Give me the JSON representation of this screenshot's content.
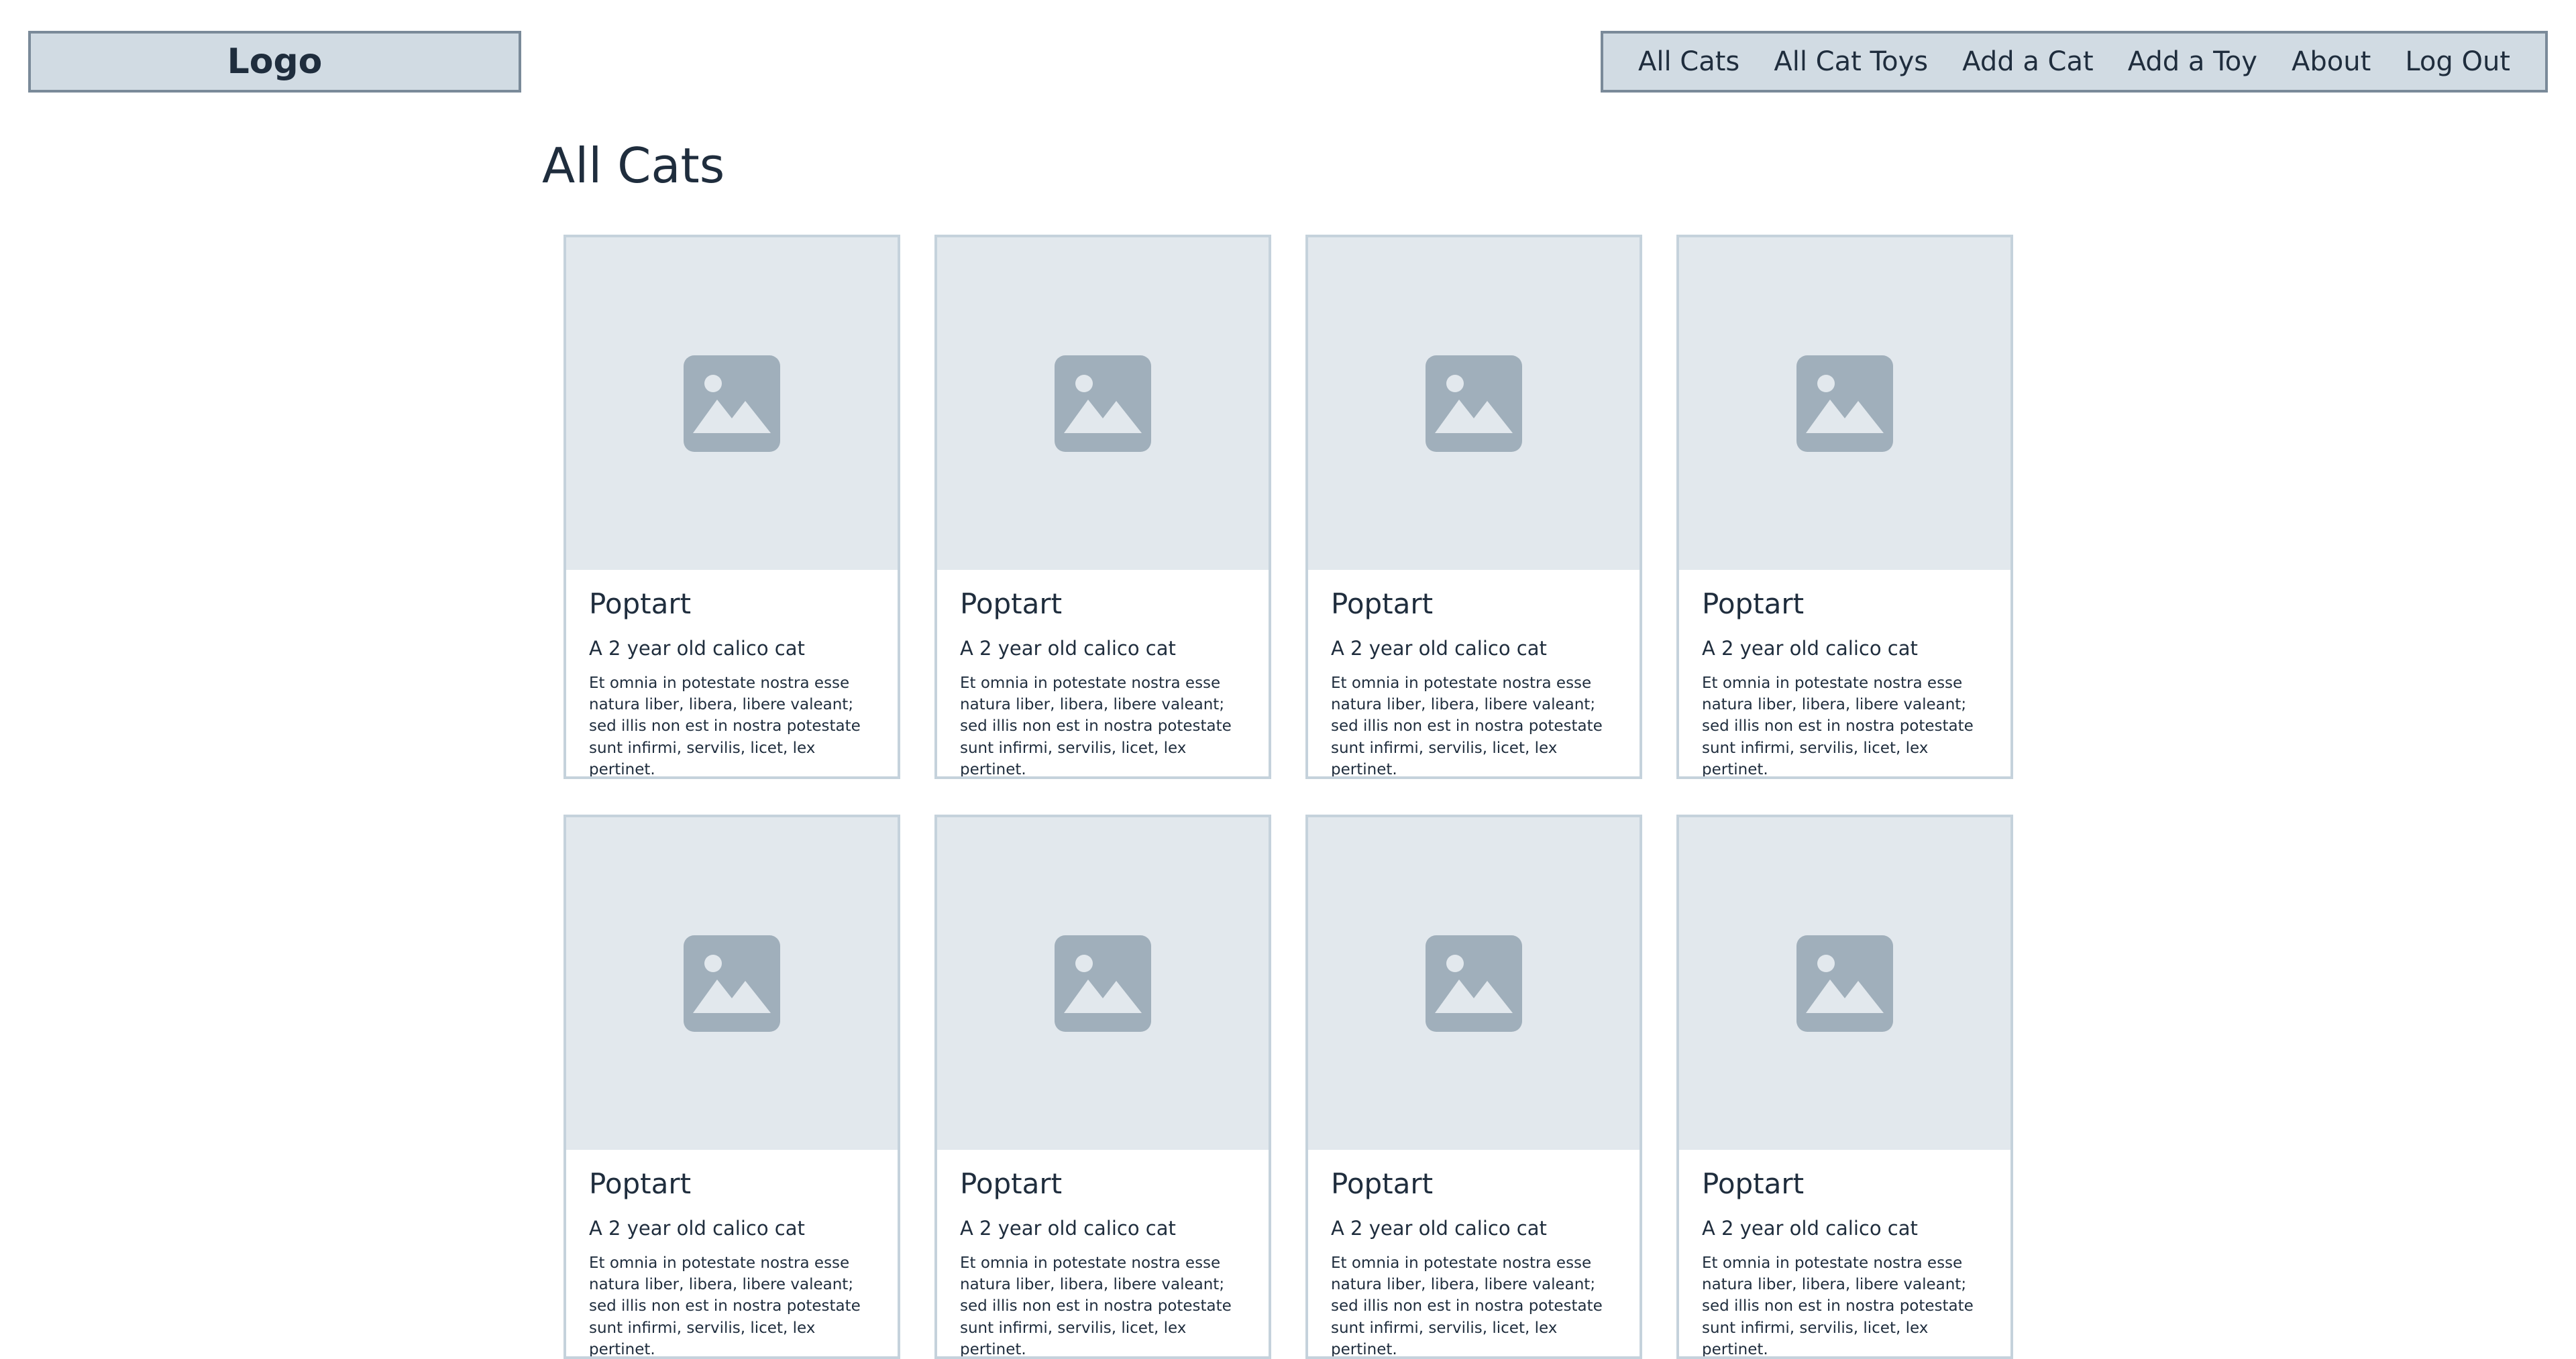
{
  "header": {
    "logo_label": "Logo",
    "nav": [
      "All Cats",
      "All Cat Toys",
      "Add a Cat",
      "Add a Toy",
      "About",
      "Log Out"
    ]
  },
  "main": {
    "title": "All Cats",
    "cards": [
      {
        "name": "Poptart",
        "subtitle": "A 2 year old calico cat",
        "description": "Et omnia in potestate nostra esse natura liber, libera, libere valeant; sed illis non est in nostra potestate sunt infirmi, servilis, licet, lex pertinet.",
        "image_icon": "image-placeholder-icon"
      },
      {
        "name": "Poptart",
        "subtitle": "A 2 year old calico cat",
        "description": "Et omnia in potestate nostra esse natura liber, libera, libere valeant; sed illis non est in nostra potestate sunt infirmi, servilis, licet, lex pertinet.",
        "image_icon": "image-placeholder-icon"
      },
      {
        "name": "Poptart",
        "subtitle": "A 2 year old calico cat",
        "description": "Et omnia in potestate nostra esse natura liber, libera, libere valeant; sed illis non est in nostra potestate sunt infirmi, servilis, licet, lex pertinet.",
        "image_icon": "image-placeholder-icon"
      },
      {
        "name": "Poptart",
        "subtitle": "A 2 year old calico cat",
        "description": "Et omnia in potestate nostra esse natura liber, libera, libere valeant; sed illis non est in nostra potestate sunt infirmi, servilis, licet, lex pertinet.",
        "image_icon": "image-placeholder-icon"
      },
      {
        "name": "Poptart",
        "subtitle": "A 2 year old calico cat",
        "description": "Et omnia in potestate nostra esse natura liber, libera, libere valeant; sed illis non est in nostra potestate sunt infirmi, servilis, licet, lex pertinet.",
        "image_icon": "image-placeholder-icon"
      },
      {
        "name": "Poptart",
        "subtitle": "A 2 year old calico cat",
        "description": "Et omnia in potestate nostra esse natura liber, libera, libere valeant; sed illis non est in nostra potestate sunt infirmi, servilis, licet, lex pertinet.",
        "image_icon": "image-placeholder-icon"
      },
      {
        "name": "Poptart",
        "subtitle": "A 2 year old calico cat",
        "description": "Et omnia in potestate nostra esse natura liber, libera, libere valeant; sed illis non est in nostra potestate sunt infirmi, servilis, licet, lex pertinet.",
        "image_icon": "image-placeholder-icon"
      },
      {
        "name": "Poptart",
        "subtitle": "A 2 year old calico cat",
        "description": "Et omnia in potestate nostra esse natura liber, libera, libere valeant; sed illis non est in nostra potestate sunt infirmi, servilis, licet, lex pertinet.",
        "image_icon": "image-placeholder-icon"
      }
    ]
  },
  "colors": {
    "header_bg": "#d1dbe3",
    "header_border": "#7a8a99",
    "text": "#1f2d3d",
    "card_border": "#c5d2dc",
    "image_bg": "#e2e8ed",
    "icon": "#a0afbb"
  }
}
